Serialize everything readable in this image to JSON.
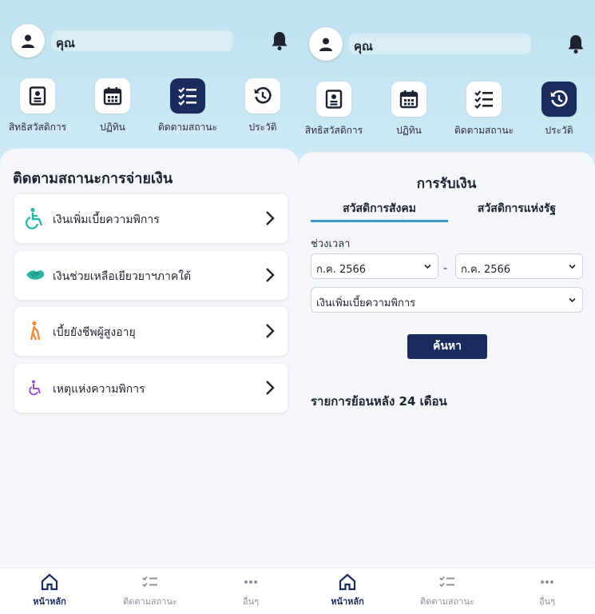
{
  "left": {
    "header": {
      "name": "คุณ"
    },
    "quick_menu": [
      {
        "label": "สิทธิสวัสดิการ",
        "icon": "id-card-icon",
        "active": false
      },
      {
        "label": "ปฏิทิน",
        "icon": "calendar-icon",
        "active": false
      },
      {
        "label": "ติดตามสถานะ",
        "icon": "checklist-icon",
        "active": true
      },
      {
        "label": "ประวัติ",
        "icon": "history-icon",
        "active": false
      }
    ],
    "section_title": "ติดตามสถานะการจ่ายเงิน",
    "items": [
      {
        "label": "เงินเพิ่มเบี้ยความพิการ",
        "icon": "wheelchair-icon"
      },
      {
        "label": "เงินช่วยเหลือเยียวยาฯภาคใต้",
        "icon": "handshake-icon"
      },
      {
        "label": "เบี้ยยังชีพผู้สูงอายุ",
        "icon": "elderly-icon"
      },
      {
        "label": "เหตุแห่งความพิการ",
        "icon": "disability-icon"
      }
    ],
    "bottom_nav": [
      {
        "label": "หน้าหลัก",
        "icon": "home-icon",
        "active": true
      },
      {
        "label": "ติดตามสถานะ",
        "icon": "checklist-icon",
        "active": false
      },
      {
        "label": "อื่นๆ",
        "icon": "more-icon",
        "active": false
      }
    ]
  },
  "right": {
    "header": {
      "name": "คุณ"
    },
    "quick_menu": [
      {
        "label": "สิทธิสวัสดิการ",
        "icon": "id-card-icon",
        "active": false
      },
      {
        "label": "ปฏิทิน",
        "icon": "calendar-icon",
        "active": false
      },
      {
        "label": "ติดตามสถานะ",
        "icon": "checklist-icon",
        "active": false
      },
      {
        "label": "ประวัติ",
        "icon": "history-icon",
        "active": true
      }
    ],
    "title": "การรับเงิน",
    "tabs": [
      {
        "label": "สวัสดิการสังคม",
        "active": true
      },
      {
        "label": "สวัสดิการแห่งรัฐ",
        "active": false
      }
    ],
    "period_label": "ช่วงเวลา",
    "from_value": "ก.ค. 2566",
    "to_value": "ก.ค. 2566",
    "separator": "-",
    "type_value": "เงินเพิ่มเบี้ยความพิการ",
    "search_label": "ค้นหา",
    "history_note": "รายการย้อนหลัง 24 เดือน",
    "bottom_nav": [
      {
        "label": "หน้าหลัก",
        "icon": "home-icon",
        "active": true
      },
      {
        "label": "ติดตามสถานะ",
        "icon": "checklist-icon",
        "active": false
      },
      {
        "label": "อื่นๆ",
        "icon": "more-icon",
        "active": false
      }
    ]
  },
  "colors": {
    "navy": "#1a2c5e",
    "sky": "#bfe2f1",
    "accent": "#3d9ad1",
    "teal": "#2bb3a3"
  }
}
